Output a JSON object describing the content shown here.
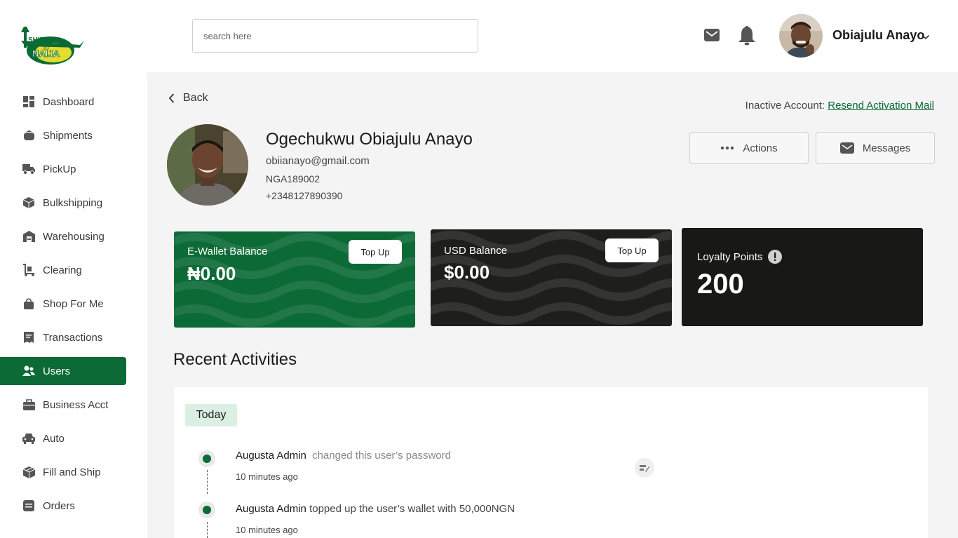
{
  "brand": {
    "logo_text_top": "SHIP",
    "logo_text_mid": "to",
    "logo_text_bottom": "NAIJA"
  },
  "search": {
    "placeholder": "search here"
  },
  "user": {
    "name": "Obiajulu Anayo"
  },
  "sidebar": {
    "items": [
      {
        "label": "Dashboard",
        "icon": "dashboard-icon"
      },
      {
        "label": "Shipments",
        "icon": "shipments-icon"
      },
      {
        "label": "PickUp",
        "icon": "pickup-truck-icon"
      },
      {
        "label": "Bulkshipping",
        "icon": "box-icon"
      },
      {
        "label": "Warehousing",
        "icon": "warehouse-icon"
      },
      {
        "label": "Clearing",
        "icon": "trolley-icon"
      },
      {
        "label": "Shop For Me",
        "icon": "shopping-bag-icon"
      },
      {
        "label": "Transactions",
        "icon": "receipt-icon"
      },
      {
        "label": "Users",
        "icon": "users-icon",
        "active": true
      },
      {
        "label": "Business Acct",
        "icon": "briefcase-icon"
      },
      {
        "label": "Auto",
        "icon": "car-icon"
      },
      {
        "label": "Fill and Ship",
        "icon": "boxes-icon"
      },
      {
        "label": "Orders",
        "icon": "orders-icon"
      }
    ]
  },
  "page": {
    "back_label": "Back",
    "inactive_label": "Inactive Account:",
    "resend_label": "Resend Activation Mail",
    "actions_label": "Actions",
    "messages_label": "Messages"
  },
  "profile": {
    "name": "Ogechukwu Obiajulu Anayo",
    "email": "obiianayo@gmail.com",
    "customer_id": "NGA189002",
    "phone": "+2348127890390"
  },
  "cards": {
    "ewallet": {
      "label": "E-Wallet Balance",
      "amount": "₦0.00",
      "button": "Top Up",
      "color": "#0b6a35"
    },
    "usd": {
      "label": "USD Balance",
      "amount": "$0.00",
      "button": "Top Up",
      "color": "#1e1e1c"
    },
    "loyalty": {
      "label": "Loyalty Points",
      "amount": "200",
      "color": "#181816"
    }
  },
  "activities": {
    "title": "Recent Activities",
    "group": "Today",
    "items": [
      {
        "actor": "Augusta Admin",
        "action": "changed this user’s password",
        "time": "10 minutes ago"
      },
      {
        "actor": "Augusta Admin",
        "action": "topped up the user’s wallet with 50,000NGN",
        "time": "10 minutes ago"
      }
    ]
  }
}
